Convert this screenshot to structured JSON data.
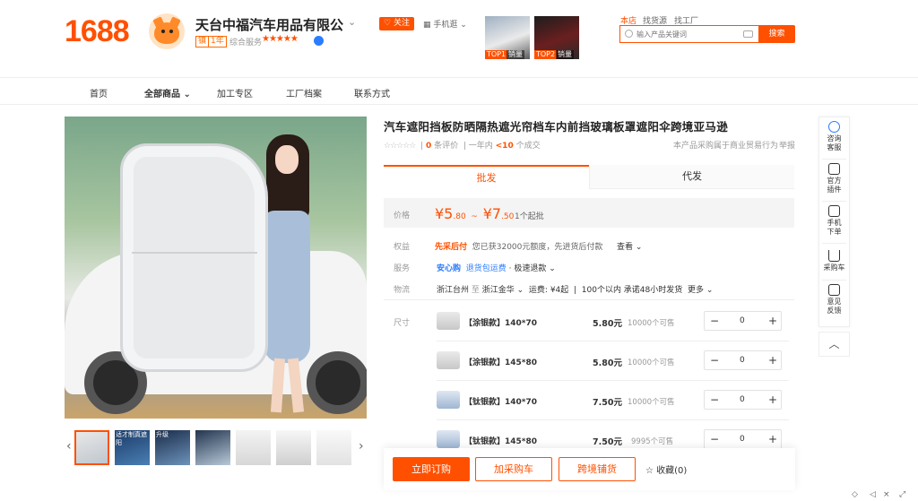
{
  "logo": "1688",
  "shop": {
    "name": "天台中福汽车用品有限公",
    "badge1": "镇",
    "badge2": "1年",
    "service_label": "综合服务",
    "stars": "★★★★★",
    "follow": "关注",
    "mobile": "手机逛"
  },
  "top_products": [
    {
      "tag": "TOP1",
      "label": "销量"
    },
    {
      "tag": "TOP2",
      "label": "销量"
    }
  ],
  "search": {
    "scopes": [
      "本店",
      "找货源",
      "找工厂"
    ],
    "placeholder": "输入产品关键词",
    "button": "搜索"
  },
  "nav": [
    "首页",
    "全部商品",
    "加工专区",
    "工厂档案",
    "联系方式"
  ],
  "thumbnails": [
    {
      "text": ""
    },
    {
      "text": "适才制真遮阳"
    },
    {
      "text": "升级"
    },
    {
      "text": ""
    },
    {
      "text": ""
    },
    {
      "text": ""
    },
    {
      "text": ""
    }
  ],
  "product": {
    "title": "汽车遮阳挡板防晒隔热遮光帘档车内前挡玻璃板罩遮阳伞跨境亚马逊",
    "rating_stars": "☆☆☆☆☆",
    "reviews_count": "0",
    "reviews_label": "条评价",
    "period": "一年内",
    "deals": "<10",
    "deals_label": "个成交",
    "trade_note": "本产品采购属于商业贸易行为",
    "report": "举报",
    "tabs": [
      "批发",
      "代发"
    ],
    "price_label": "价格",
    "price_low_int": "¥5",
    "price_low_dec": ".80",
    "price_sep": "~",
    "price_high_int": "¥7",
    "price_high_dec": ".50",
    "moq": "1个起批",
    "benefit_label": "权益",
    "benefit_tag": "先采后付",
    "benefit_text": "您已获32000元额度，先进货后付款",
    "benefit_more": "查看",
    "service_label": "服务",
    "service_tag": "安心购",
    "service_1": "退货包运费",
    "service_2": "· 极速退款",
    "logistics_label": "物流",
    "from": "浙江台州",
    "to_sep": "至",
    "to": "浙江金华",
    "fee": "运费: ¥4起",
    "ship_note": "100个以内 承诺48小时发货",
    "ship_more": "更多",
    "size_label": "尺寸"
  },
  "skus": [
    {
      "name": "【涂银款】140*70",
      "price": "5.80元",
      "stock": "10000个可售",
      "qty": "0"
    },
    {
      "name": "【涂银款】145*80",
      "price": "5.80元",
      "stock": "10000个可售",
      "qty": "0"
    },
    {
      "name": "【钛银款】140*70",
      "price": "7.50元",
      "stock": "10000个可售",
      "qty": "0"
    },
    {
      "name": "【钛银款】145*80",
      "price": "7.50元",
      "stock": "9995个可售",
      "qty": "0"
    }
  ],
  "actions": {
    "buy": "立即订购",
    "cart": "加采购车",
    "cross": "跨境铺货",
    "fav": "收藏(0)"
  },
  "sidebar": [
    {
      "label": "咨询客服",
      "icon": "chat-icon"
    },
    {
      "label": "官方插件",
      "icon": "puzzle-icon"
    },
    {
      "label": "手机下单",
      "icon": "qrcode-icon"
    },
    {
      "label": "采购车",
      "icon": "cart-icon"
    },
    {
      "label": "意见反馈",
      "icon": "edit-icon"
    }
  ],
  "colors": {
    "accent": "#ff5000",
    "blue": "#2b7cff"
  }
}
